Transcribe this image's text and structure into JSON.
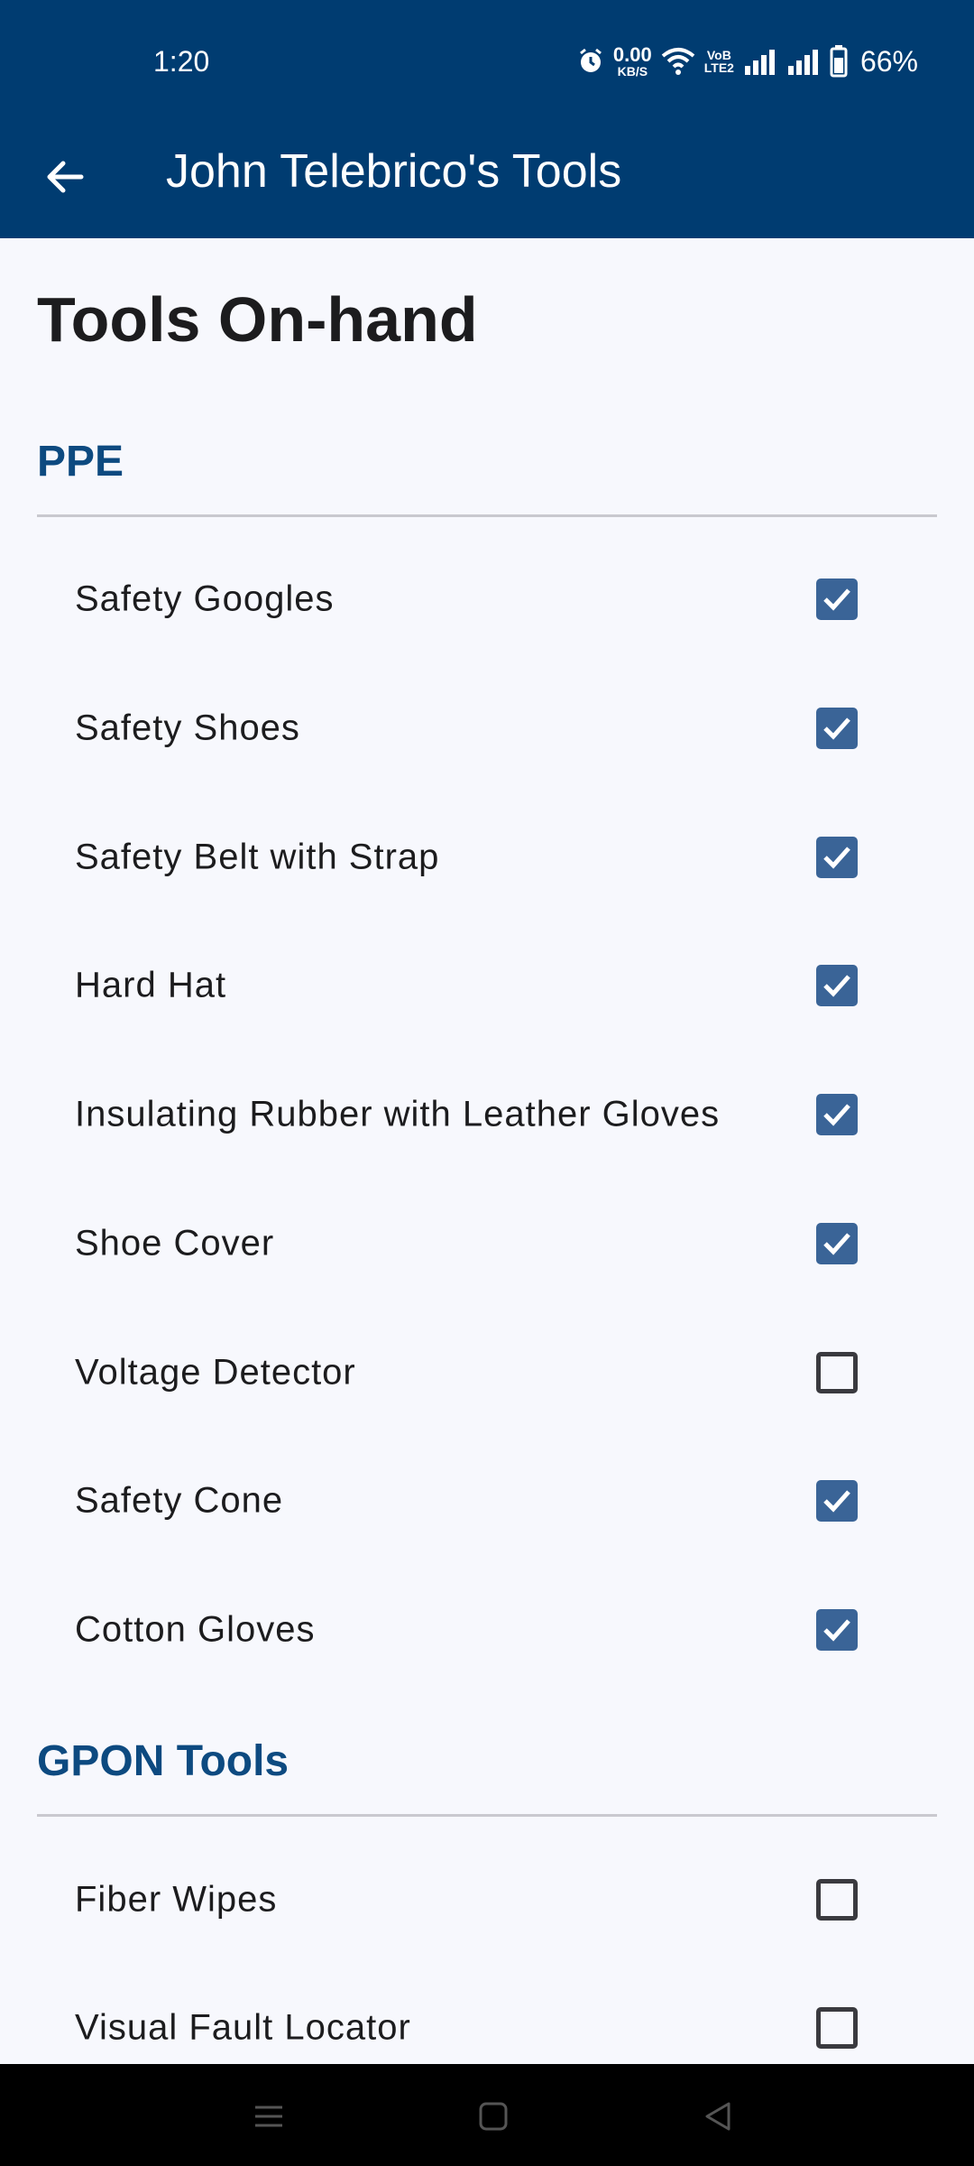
{
  "status_bar": {
    "time": "1:20",
    "net_speed_value": "0.00",
    "net_speed_unit": "KB/S",
    "volte_top": "VoB",
    "volte_bottom": "LTE2",
    "battery": "66%",
    "icons": [
      "alarm-icon",
      "wifi-icon",
      "signal-icon",
      "signal-icon",
      "battery-icon"
    ]
  },
  "app_bar": {
    "title": "John Telebrico's Tools",
    "back_icon": "arrow-left-icon"
  },
  "page": {
    "title": "Tools On-hand"
  },
  "sections": [
    {
      "name": "PPE",
      "items": [
        {
          "label": "Safety Googles",
          "checked": true
        },
        {
          "label": "Safety Shoes",
          "checked": true
        },
        {
          "label": "Safety Belt with Strap",
          "checked": true
        },
        {
          "label": "Hard Hat",
          "checked": true
        },
        {
          "label": "Insulating Rubber with Leather Gloves",
          "checked": true
        },
        {
          "label": "Shoe Cover",
          "checked": true
        },
        {
          "label": "Voltage Detector",
          "checked": false
        },
        {
          "label": "Safety Cone",
          "checked": true
        },
        {
          "label": "Cotton Gloves",
          "checked": true
        }
      ]
    },
    {
      "name": "GPON Tools",
      "items": [
        {
          "label": "Fiber Wipes",
          "checked": false
        },
        {
          "label": "Visual Fault Locator",
          "checked": false
        }
      ]
    }
  ],
  "nav_bar": {
    "icons": [
      "menu-icon",
      "home-icon",
      "back-triangle-icon"
    ]
  },
  "colors": {
    "app_bar": "#003c71",
    "section_header": "#0d4a80",
    "checkbox_checked": "#3a6497",
    "background": "#f7f8fd"
  }
}
